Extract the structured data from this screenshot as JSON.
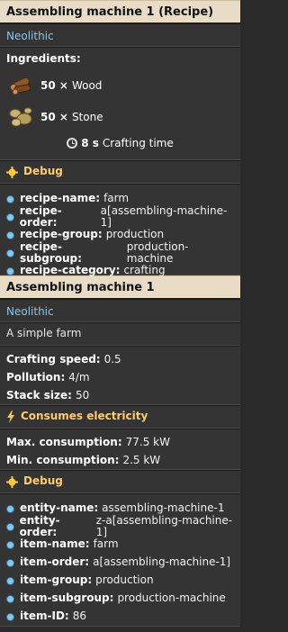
{
  "recipe_panel": {
    "header_title": "Assembling machine 1 (Recipe)",
    "tier": "Neolithic",
    "ingredients_title": "Ingredients:",
    "ingredients": [
      {
        "qty": "50 ×",
        "name": "Wood",
        "icon": "wood-log-icon"
      },
      {
        "qty": "50 ×",
        "name": "Stone",
        "icon": "stone-icon"
      }
    ],
    "crafting_time_value": "8 s",
    "crafting_time_label": "Crafting time",
    "debug": {
      "title": "Debug",
      "rows": [
        {
          "key": "recipe-name:",
          "value": "farm"
        },
        {
          "key": "recipe-order:",
          "value": "a[assembling-machine-1]"
        },
        {
          "key": "recipe-group:",
          "value": "production"
        },
        {
          "key": "recipe-subgroup:",
          "value": "production-machine"
        },
        {
          "key": "recipe-category:",
          "value": "crafting"
        }
      ]
    }
  },
  "entity_panel": {
    "header_title": "Assembling machine 1",
    "tier": "Neolithic",
    "description": "A simple farm",
    "stats": [
      {
        "key": "Crafting speed:",
        "value": "0.5"
      },
      {
        "key": "Pollution:",
        "value": "4/m"
      },
      {
        "key": "Stack size:",
        "value": "50"
      }
    ],
    "electricity": {
      "title": "Consumes electricity",
      "rows": [
        {
          "key": "Max. consumption:",
          "value": "77.5 kW"
        },
        {
          "key": "Min. consumption:",
          "value": "2.5 kW"
        }
      ]
    },
    "debug": {
      "title": "Debug",
      "rows": [
        {
          "key": "entity-name:",
          "value": "assembling-machine-1"
        },
        {
          "key": "entity-order:",
          "value": "z-a[assembling-machine-1]"
        },
        {
          "key": "item-name:",
          "value": "farm"
        },
        {
          "key": "item-order:",
          "value": "a[assembling-machine-1]"
        },
        {
          "key": "item-group:",
          "value": "production"
        },
        {
          "key": "item-subgroup:",
          "value": "production-machine"
        },
        {
          "key": "item-ID:",
          "value": "86"
        }
      ]
    }
  },
  "colors": {
    "header_bg": "#e8dcc6",
    "tier_blue": "#87c6f1",
    "section_orange": "#ffcc66",
    "panel_bg": "#343434"
  }
}
